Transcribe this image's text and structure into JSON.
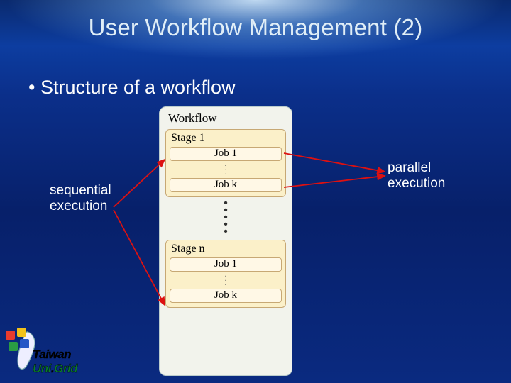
{
  "title": "User Workflow Management (2)",
  "bullet": "Structure of a workflow",
  "diagram": {
    "label": "Workflow",
    "stage1": {
      "title": "Stage 1",
      "job_first": "Job 1",
      "job_last": "Job k"
    },
    "stage2": {
      "title": "Stage n",
      "job_first": "Job 1",
      "job_last": "Job k"
    }
  },
  "annot_left_l1": "sequential",
  "annot_left_l2": "execution",
  "annot_right_l1": "parallel",
  "annot_right_l2": "execution",
  "logo_text": "Taiwan",
  "logo_text2_a": "Uni",
  "logo_text2_b": "Grid",
  "colors": {
    "sq1": "#e83b2e",
    "sq2": "#f2c21a",
    "sq3": "#2a9b44",
    "sq4": "#2557c6"
  }
}
